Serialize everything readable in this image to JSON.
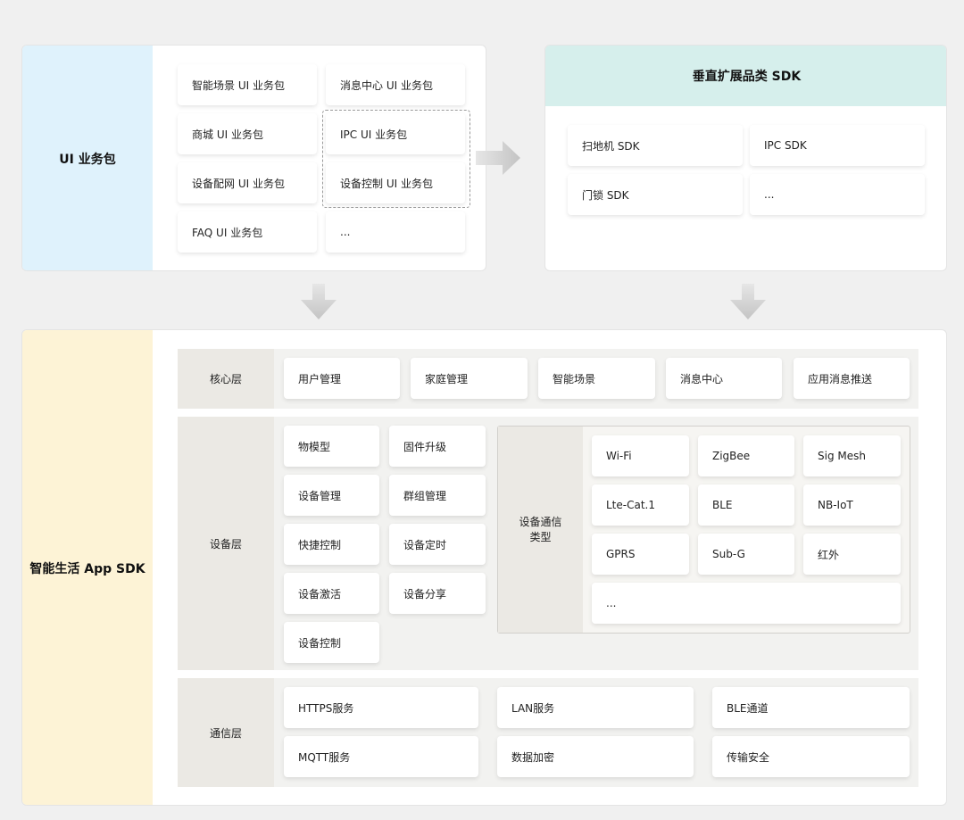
{
  "ui_packages": {
    "label": "UI 业务包",
    "items": [
      "智能场景 UI 业务包",
      "消息中心 UI 业务包",
      "商城 UI 业务包",
      "IPC UI 业务包",
      "设备配网 UI 业务包",
      "设备控制 UI 业务包",
      "FAQ UI 业务包",
      "..."
    ]
  },
  "vertical_sdk": {
    "title": "垂直扩展品类 SDK",
    "items": [
      "扫地机 SDK",
      "IPC SDK",
      "门锁 SDK",
      "..."
    ]
  },
  "app_sdk": {
    "label": "智能生活 App SDK",
    "core_layer": {
      "label": "核心层",
      "items": [
        "用户管理",
        "家庭管理",
        "智能场景",
        "消息中心",
        "应用消息推送"
      ]
    },
    "device_layer": {
      "label": "设备层",
      "items": [
        "物模型",
        "固件升级",
        "设备管理",
        "群组管理",
        "快捷控制",
        "设备定时",
        "设备激活",
        "设备分享",
        "设备控制"
      ],
      "comm_types": {
        "label": "设备通信类型",
        "items": [
          "Wi-Fi",
          "ZigBee",
          "Sig Mesh",
          "Lte-Cat.1",
          "BLE",
          "NB-IoT",
          "GPRS",
          "Sub-G",
          "红外",
          "..."
        ]
      }
    },
    "comm_layer": {
      "label": "通信层",
      "items": [
        "HTTPS服务",
        "LAN服务",
        "BLE通道",
        "MQTT服务",
        "数据加密",
        "传输安全"
      ]
    }
  },
  "colors": {
    "ui_package_side": "#dff2fc",
    "app_sdk_side": "#fdf3d6",
    "vertical_header": "#d6efec",
    "arrow": "#c8c8c8"
  },
  "icons": {
    "right_arrow": "arrow-right-icon",
    "down_arrow": "arrow-down-icon"
  }
}
